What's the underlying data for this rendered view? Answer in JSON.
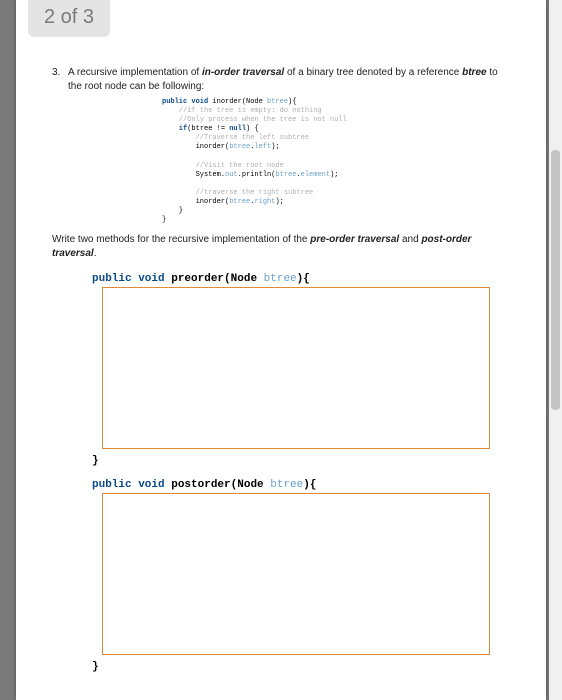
{
  "badge": "2 of 3",
  "question": {
    "number": "3.",
    "text_a": "A recursive implementation of ",
    "term1": "in-order traversal",
    "text_b": " of a binary tree denoted by a reference ",
    "term2": "btree",
    "text_c": " to the root node can be following:"
  },
  "code": {
    "l1a": "public void",
    "l1b": " inorder(Node ",
    "l1c": "btree",
    "l1d": "){",
    "l2": "    //if the tree is empty: do nothing",
    "l3": "    //Only process when the tree is not null",
    "l4a": "    if",
    "l4b": "(btree != ",
    "l4c": "null",
    "l4d": ") {",
    "l5": "        //Traverse the left subtree",
    "l6a": "        inorder(",
    "l6b": "btree",
    "l6c": ".",
    "l6d": "left",
    "l6e": ");",
    "l7": "",
    "l8": "        //Visit the root node",
    "l9a": "        System.",
    "l9b": "out",
    "l9c": ".println(",
    "l9d": "btree",
    "l9e": ".",
    "l9f": "element",
    "l9g": ");",
    "l10": "",
    "l11": "        //traverse the right subtree",
    "l12a": "        inorder(",
    "l12b": "btree",
    "l12c": ".",
    "l12d": "right",
    "l12e": ");",
    "l13": "    }",
    "l14": "}"
  },
  "followup": {
    "text_a": "Write two methods for the recursive implementation of the ",
    "term1": "pre-order traversal",
    "text_b": " and ",
    "term2": "post-order traversal",
    "text_c": "."
  },
  "sig1": {
    "a": "public void",
    "b": " preorder(Node ",
    "c": "btree",
    "d": "){"
  },
  "sig2": {
    "a": "public void",
    "b": " postorder(Node ",
    "c": "btree",
    "d": "){"
  },
  "brace": "}"
}
